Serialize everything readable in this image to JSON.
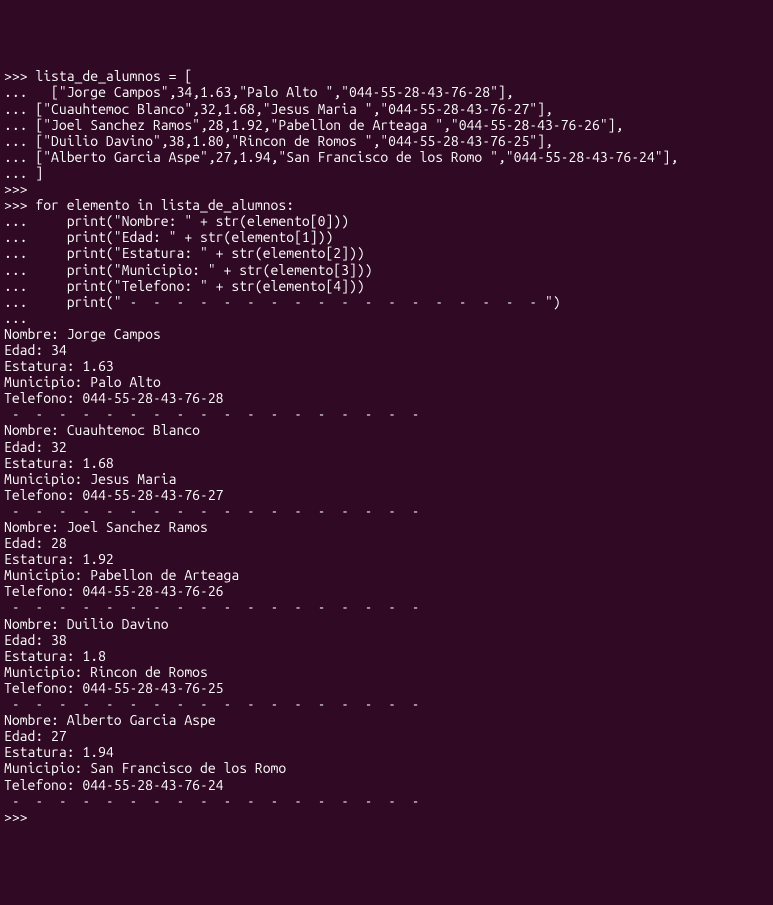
{
  "lines": [
    ">>> lista_de_alumnos = [",
    "...   [\"Jorge Campos\",34,1.63,\"Palo Alto \",\"044-55-28-43-76-28\"],",
    "... [\"Cuauhtemoc Blanco\",32,1.68,\"Jesus Maria \",\"044-55-28-43-76-27\"],",
    "... [\"Joel Sanchez Ramos\",28,1.92,\"Pabellon de Arteaga \",\"044-55-28-43-76-26\"],",
    "... [\"Duilio Davino\",38,1.80,\"Rincon de Romos \",\"044-55-28-43-76-25\"],",
    "... [\"Alberto Garcia Aspe\",27,1.94,\"San Francisco de los Romo \",\"044-55-28-43-76-24\"],",
    "... ]",
    ">>> ",
    ">>> for elemento in lista_de_alumnos:",
    "...     print(\"Nombre: \" + str(elemento[0]))",
    "...     print(\"Edad: \" + str(elemento[1]))",
    "...     print(\"Estatura: \" + str(elemento[2]))",
    "...     print(\"Municipio: \" + str(elemento[3]))",
    "...     print(\"Telefono: \" + str(elemento[4]))",
    "...     print(\" -  -  -  -  -  -  -  -  -  -  -  -  -  -  -  -  -  - \")",
    "... ",
    "Nombre: Jorge Campos",
    "Edad: 34",
    "Estatura: 1.63",
    "Municipio: Palo Alto ",
    "Telefono: 044-55-28-43-76-28",
    " -  -  -  -  -  -  -  -  -  -  -  -  -  -  -  -  -  - ",
    "Nombre: Cuauhtemoc Blanco",
    "Edad: 32",
    "Estatura: 1.68",
    "Municipio: Jesus Maria ",
    "Telefono: 044-55-28-43-76-27",
    " -  -  -  -  -  -  -  -  -  -  -  -  -  -  -  -  -  - ",
    "Nombre: Joel Sanchez Ramos",
    "Edad: 28",
    "Estatura: 1.92",
    "Municipio: Pabellon de Arteaga ",
    "Telefono: 044-55-28-43-76-26",
    " -  -  -  -  -  -  -  -  -  -  -  -  -  -  -  -  -  - ",
    "Nombre: Duilio Davino",
    "Edad: 38",
    "Estatura: 1.8",
    "Municipio: Rincon de Romos ",
    "Telefono: 044-55-28-43-76-25",
    " -  -  -  -  -  -  -  -  -  -  -  -  -  -  -  -  -  - ",
    "Nombre: Alberto Garcia Aspe",
    "Edad: 27",
    "Estatura: 1.94",
    "Municipio: San Francisco de los Romo ",
    "Telefono: 044-55-28-43-76-24",
    " -  -  -  -  -  -  -  -  -  -  -  -  -  -  -  -  -  - ",
    ">>> "
  ]
}
